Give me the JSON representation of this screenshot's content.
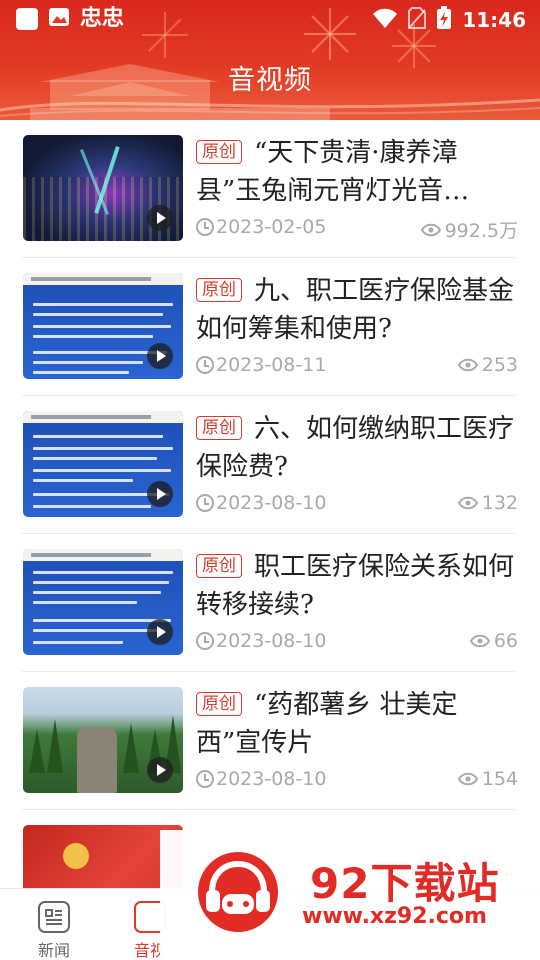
{
  "status_bar": {
    "app_name": "忠忠",
    "time": "11:46"
  },
  "header": {
    "title": "音视频"
  },
  "articles": [
    {
      "tag": "原创",
      "title": "“天下贵清·康养漳县”玉兔闹元宵灯光音…",
      "date": "2023-02-05",
      "views": "992.5万",
      "thumbnail": "night-town-light-show",
      "thumb_lines": []
    },
    {
      "tag": "原创",
      "title": "九、职工医疗保险基金如何筹集和使用?",
      "date": "2023-08-11",
      "views": "253",
      "thumbnail": "blue-text-slide",
      "thumb_lines": [
        30,
        46,
        62,
        78,
        94
      ]
    },
    {
      "tag": "原创",
      "title": "六、如何缴纳职工医疗保险费?",
      "date": "2023-08-10",
      "views": "132",
      "thumbnail": "blue-text-slide",
      "thumb_lines": [
        26,
        40,
        54,
        68,
        82,
        96
      ]
    },
    {
      "tag": "原创",
      "title": "职工医疗保险关系如何转移接续?",
      "date": "2023-08-10",
      "views": "66",
      "thumbnail": "blue-text-slide",
      "thumb_lines": [
        24,
        38,
        52,
        72,
        86,
        98
      ]
    },
    {
      "tag": "原创",
      "title": "“药都薯乡 壮美定西”宣传片",
      "date": "2023-08-10",
      "views": "154",
      "thumbnail": "forest-landscape",
      "thumb_lines": []
    }
  ],
  "bottom_nav": {
    "items": [
      {
        "label": "新闻",
        "icon": "news-icon",
        "active": false
      },
      {
        "label": "音视",
        "icon": "video-icon",
        "active": true
      }
    ]
  },
  "watermark": {
    "brand": "92下载站",
    "url": "www.xz92.com"
  },
  "colors": {
    "header_red": "#d9281c",
    "accent_red": "#d83b2e",
    "meta_gray": "#a9a9a9"
  }
}
